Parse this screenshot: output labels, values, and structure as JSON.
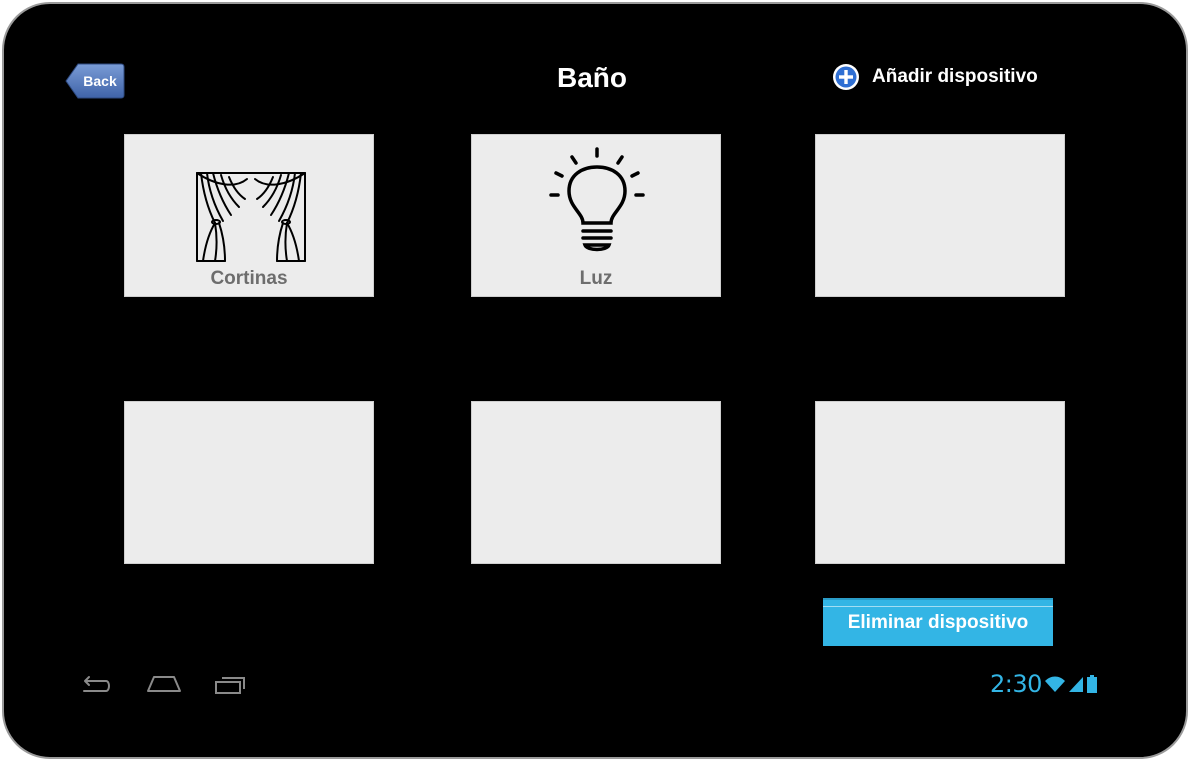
{
  "header": {
    "back_label": "Back",
    "title": "Baño",
    "add_device_label": "Añadir dispositivo"
  },
  "devices": [
    {
      "label": "Cortinas",
      "icon": "curtain-icon"
    },
    {
      "label": "Luz",
      "icon": "lightbulb-icon"
    },
    {
      "label": "",
      "icon": ""
    },
    {
      "label": "",
      "icon": ""
    },
    {
      "label": "",
      "icon": ""
    },
    {
      "label": "",
      "icon": ""
    }
  ],
  "actions": {
    "delete_device_label": "Eliminar dispositivo"
  },
  "status_bar": {
    "time": "2:30",
    "icons": [
      "wifi-icon",
      "signal-icon",
      "battery-icon"
    ]
  },
  "navigation_bar": {
    "icons": [
      "back-nav-icon",
      "home-nav-icon",
      "recent-apps-icon"
    ]
  },
  "colors": {
    "background": "#000000",
    "tile": "#ececec",
    "accent": "#33b5e5",
    "back_button": "#5b7fc0"
  }
}
